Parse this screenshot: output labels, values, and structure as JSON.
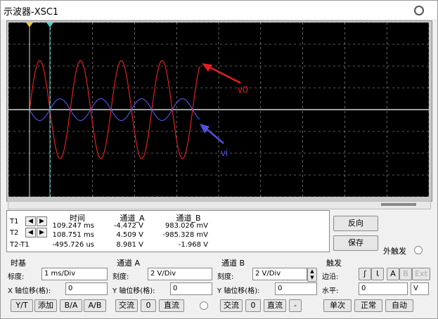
{
  "window": {
    "title": "示波器-XSC1"
  },
  "readout": {
    "rows": [
      {
        "label": "T1",
        "time": "109.247 ms",
        "a": "-4.472 V",
        "b": "983.026 mV"
      },
      {
        "label": "T2",
        "time": "108.751 ms",
        "a": "4.509 V",
        "b": "-985.328 mV"
      },
      {
        "label": "T2-T1",
        "time": "-495.726 us",
        "a": "8.981 V",
        "b": "-1.968 V"
      }
    ],
    "headers": {
      "time": "时间",
      "a": "通道_A",
      "b": "通道_B"
    }
  },
  "buttons": {
    "reverse": "反向",
    "save": "保存",
    "ext_trigger": "外触发"
  },
  "timebase": {
    "title": "时基",
    "scale_label": "标度:",
    "scale_value": "1 ms/Div",
    "xpos_label": "X 轴位移(格):",
    "xpos_value": "0",
    "modes": [
      "Y/T",
      "添加",
      "B/A",
      "A/B"
    ]
  },
  "channel_a": {
    "title": "通道 A",
    "scale_label": "刻度:",
    "scale_value": "2 V/Div",
    "ypos_label": "Y 轴位移(格):",
    "ypos_value": "0",
    "coupling": [
      "交流",
      "0",
      "直流"
    ]
  },
  "channel_b": {
    "title": "通道 B",
    "scale_label": "刻度:",
    "scale_value": "2 V/Div",
    "ypos_label": "Y 轴位移(格):",
    "ypos_value": "0",
    "coupling": [
      "交流",
      "0",
      "直流",
      "-"
    ]
  },
  "trigger": {
    "title": "触发",
    "edge_label": "边沿:",
    "edge_buttons": [
      "A",
      "B",
      "Ext"
    ],
    "level_label": "水平:",
    "level_value": "0",
    "level_unit": "V",
    "mode_buttons": [
      "单次",
      "正常",
      "自动"
    ]
  },
  "annotations": {
    "v0": "v0",
    "vi": "vi"
  },
  "colors": {
    "v0": "#e02020",
    "vi": "#5050e0",
    "cursor": "#40d0d0",
    "grid": "#ffffff",
    "screen_bg": "#000000"
  },
  "chart_data": {
    "type": "line",
    "series": [
      {
        "name": "v0",
        "amplitude": 4.5,
        "period_ms": 1.0
      },
      {
        "name": "vi",
        "amplitude": 1.0,
        "period_ms": 1.0
      }
    ],
    "x_divisions": 10,
    "y_divisions": 8,
    "grid": true
  }
}
